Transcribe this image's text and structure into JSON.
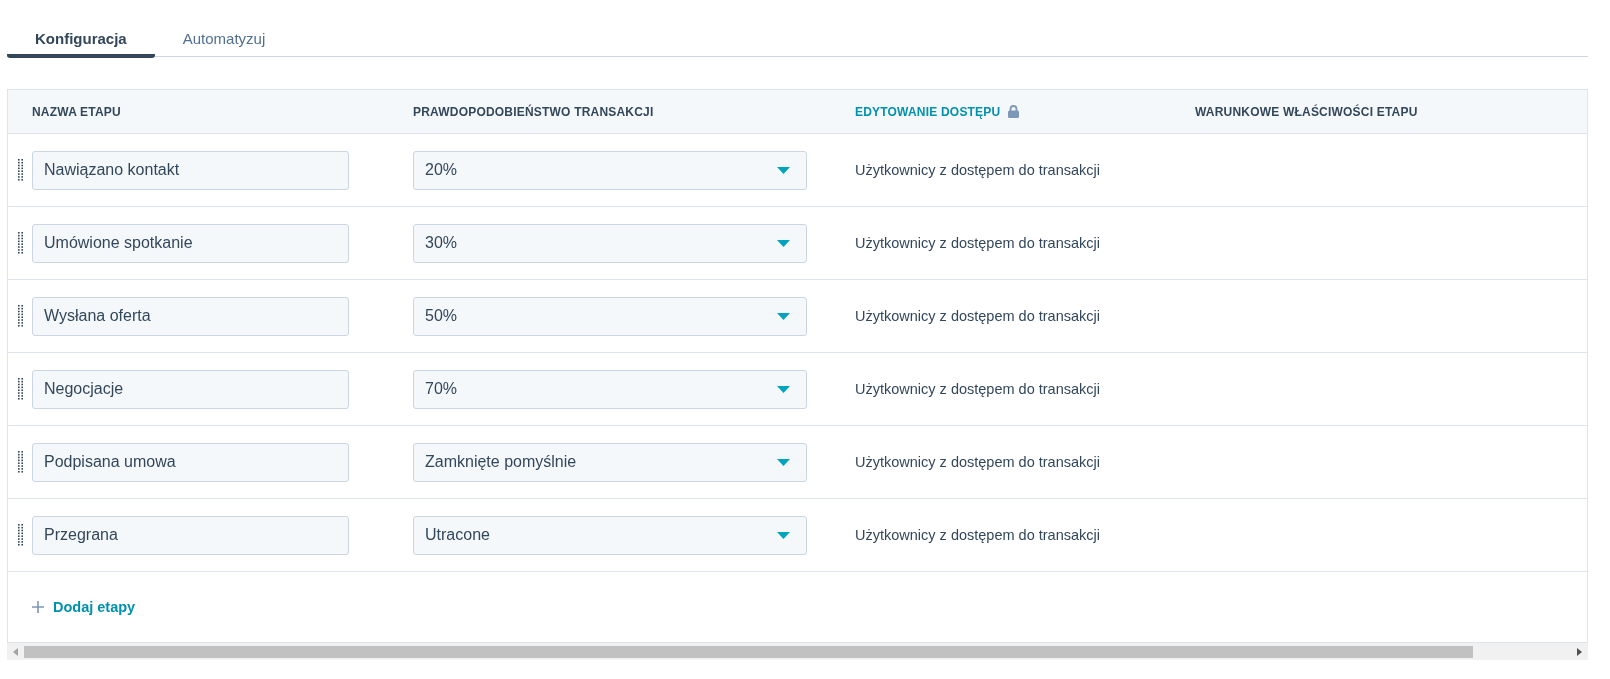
{
  "tabs": [
    {
      "label": "Konfiguracja",
      "selected": true
    },
    {
      "label": "Automatyzuj",
      "selected": false
    }
  ],
  "table": {
    "columns": [
      {
        "label": "NAZWA ETAPU",
        "kind": "plain"
      },
      {
        "label": "PRAWDOPODOBIEŃSTWO TRANSAKCJI",
        "kind": "plain"
      },
      {
        "label": "EDYTOWANIE DOSTĘPU",
        "kind": "locked"
      },
      {
        "label": "WARUNKOWE WŁAŚCIWOŚCI ETAPU",
        "kind": "plain"
      }
    ],
    "rows": [
      {
        "name": "Nawiązano kontakt",
        "probability": "20%",
        "access": "Użytkownicy z dostępem do transakcji"
      },
      {
        "name": "Umówione spotkanie",
        "probability": "30%",
        "access": "Użytkownicy z dostępem do transakcji"
      },
      {
        "name": "Wysłana oferta",
        "probability": "50%",
        "access": "Użytkownicy z dostępem do transakcji"
      },
      {
        "name": "Negocjacje",
        "probability": "70%",
        "access": "Użytkownicy z dostępem do transakcji"
      },
      {
        "name": "Podpisana umowa",
        "probability": "Zamknięte pomyślnie",
        "access": "Użytkownicy z dostępem do transakcji"
      },
      {
        "name": "Przegrana",
        "probability": "Utracone",
        "access": "Użytkownicy z dostępem do transakcji"
      }
    ]
  },
  "add_button": {
    "label": "Dodaj etapy"
  }
}
